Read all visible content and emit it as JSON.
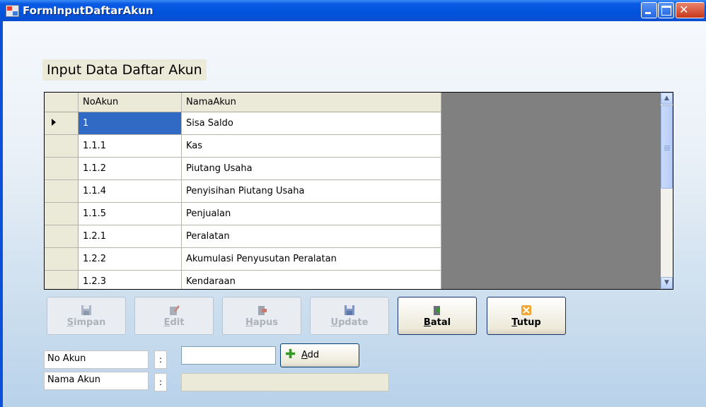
{
  "window": {
    "title": "FormInputDaftarAkun"
  },
  "heading": "Input Data Daftar Akun",
  "grid": {
    "columns": [
      "NoAkun",
      "NamaAkun"
    ],
    "rows": [
      {
        "no": "1",
        "nama": "Sisa Saldo"
      },
      {
        "no": "1.1.1",
        "nama": "Kas"
      },
      {
        "no": "1.1.2",
        "nama": "Piutang Usaha"
      },
      {
        "no": "1.1.4",
        "nama": "Penyisihan Piutang Usaha"
      },
      {
        "no": "1.1.5",
        "nama": "Penjualan"
      },
      {
        "no": "1.2.1",
        "nama": "Peralatan"
      },
      {
        "no": "1.2.2",
        "nama": "Akumulasi Penyusutan Peralatan"
      },
      {
        "no": "1.2.3",
        "nama": "Kendaraan"
      }
    ],
    "selected_row": 0
  },
  "buttons": {
    "simpan": {
      "first": "S",
      "rest": "impan",
      "enabled": false
    },
    "edit": {
      "first": "E",
      "rest": "dit",
      "enabled": false
    },
    "hapus": {
      "first": "H",
      "rest": "apus",
      "enabled": false
    },
    "update": {
      "first": "U",
      "rest": "pdate",
      "enabled": false
    },
    "batal": {
      "first": "B",
      "rest": "atal",
      "enabled": true
    },
    "tutup": {
      "first": "T",
      "rest": "utup",
      "enabled": true
    }
  },
  "form": {
    "no_akun_label": "No Akun",
    "nama_akun_label": "Nama Akun",
    "colon": ":",
    "no_akun_value": "",
    "nama_akun_value": "",
    "add_first": "A",
    "add_rest": "dd"
  }
}
